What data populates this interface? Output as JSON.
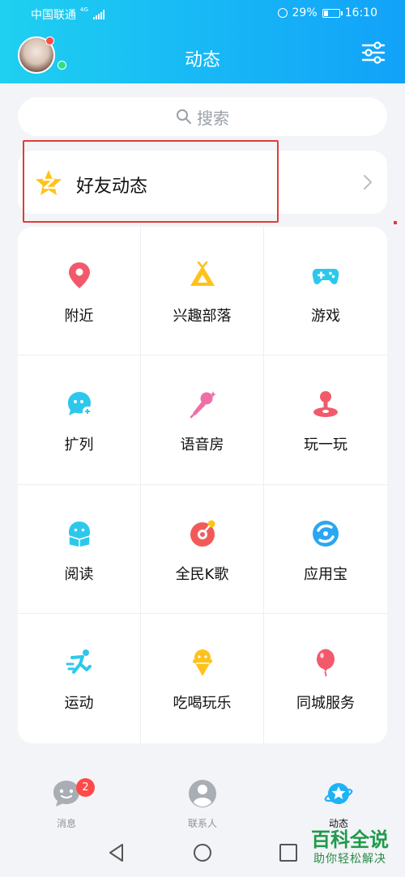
{
  "status_bar": {
    "carrier": "中国联通",
    "network": "4G",
    "battery_percent": "29%",
    "battery_level": 0.29,
    "time": "16:10"
  },
  "header": {
    "title": "动态"
  },
  "search": {
    "placeholder": "搜索"
  },
  "friends_feed": {
    "label": "好友动态"
  },
  "grid_items": [
    {
      "label": "附近",
      "icon": "location-pin-icon",
      "color": "#f25a6b"
    },
    {
      "label": "兴趣部落",
      "icon": "tribe-tent-icon",
      "color": "#ffc21a"
    },
    {
      "label": "游戏",
      "icon": "gamepad-icon",
      "color": "#2cc8ec"
    },
    {
      "label": "扩列",
      "icon": "add-friend-bubble-icon",
      "color": "#2cc8ec"
    },
    {
      "label": "语音房",
      "icon": "microphone-icon",
      "color": "#ee6fa8"
    },
    {
      "label": "玩一玩",
      "icon": "joystick-icon",
      "color": "#f25a6b"
    },
    {
      "label": "阅读",
      "icon": "reading-book-icon",
      "color": "#2cc8ec"
    },
    {
      "label": "全民K歌",
      "icon": "karaoke-icon",
      "color": "#f25a5a"
    },
    {
      "label": "应用宝",
      "icon": "app-store-icon",
      "color": "#2aa6f2"
    },
    {
      "label": "运动",
      "icon": "running-icon",
      "color": "#2cc8ec"
    },
    {
      "label": "吃喝玩乐",
      "icon": "ice-cream-icon",
      "color": "#ffc21a"
    },
    {
      "label": "同城服务",
      "icon": "balloon-icon",
      "color": "#f25a6b"
    }
  ],
  "bottom_nav": {
    "items": [
      {
        "label": "消息",
        "icon": "message-face-icon"
      },
      {
        "label": "联系人",
        "icon": "contacts-icon"
      },
      {
        "label": "动态",
        "icon": "planet-star-icon"
      }
    ],
    "unread_count": "2"
  },
  "watermark": {
    "main": "百科全说",
    "sub": "助你轻松解决"
  },
  "colors": {
    "header_gradient_start": "#1fd0f0",
    "header_gradient_end": "#12a2f8",
    "highlight": "#e23a3a",
    "badge": "#ff4a4a"
  }
}
